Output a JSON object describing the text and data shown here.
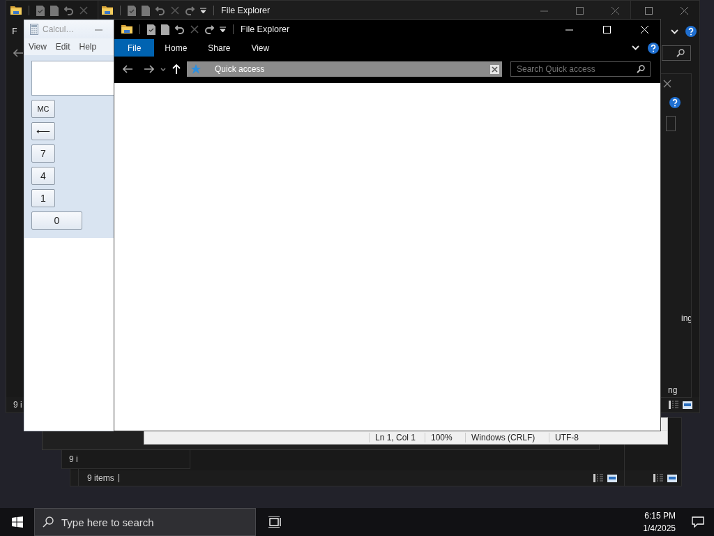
{
  "back_explorer": {
    "ribbon_tab": "F",
    "status": "9 i"
  },
  "side_window": {
    "partial_texts": [
      "ing",
      "ng"
    ]
  },
  "explorer_2": {
    "title": "File Explorer"
  },
  "explorer_4": {
    "status": "9 items"
  },
  "explorer_3": {
    "status": "9 i"
  },
  "notepad": {
    "status_fields": [
      "Ln 1, Col 1",
      "100%",
      "Windows (CRLF)",
      "UTF-8"
    ]
  },
  "calculator": {
    "title": "Calcul…",
    "menu": [
      "View",
      "Edit",
      "Help"
    ],
    "buttons": [
      {
        "label": "MC",
        "kind": "key"
      },
      {
        "label": "⟵",
        "kind": "key"
      },
      {
        "label": "7",
        "kind": "key"
      },
      {
        "label": "4",
        "kind": "key"
      },
      {
        "label": "1",
        "kind": "key"
      },
      {
        "label": "0",
        "kind": "wide"
      }
    ]
  },
  "file_explorer": {
    "title": "File Explorer",
    "tabs": [
      {
        "label": "File",
        "selected": true
      },
      {
        "label": "Home",
        "selected": false
      },
      {
        "label": "Share",
        "selected": false
      },
      {
        "label": "View",
        "selected": false
      }
    ],
    "address": "Quick access",
    "search": {
      "placeholder": "Search Quick access"
    }
  },
  "taskbar": {
    "search": {
      "placeholder": "Type here to search"
    },
    "time": "6:15 PM",
    "date": "1/4/2025"
  }
}
